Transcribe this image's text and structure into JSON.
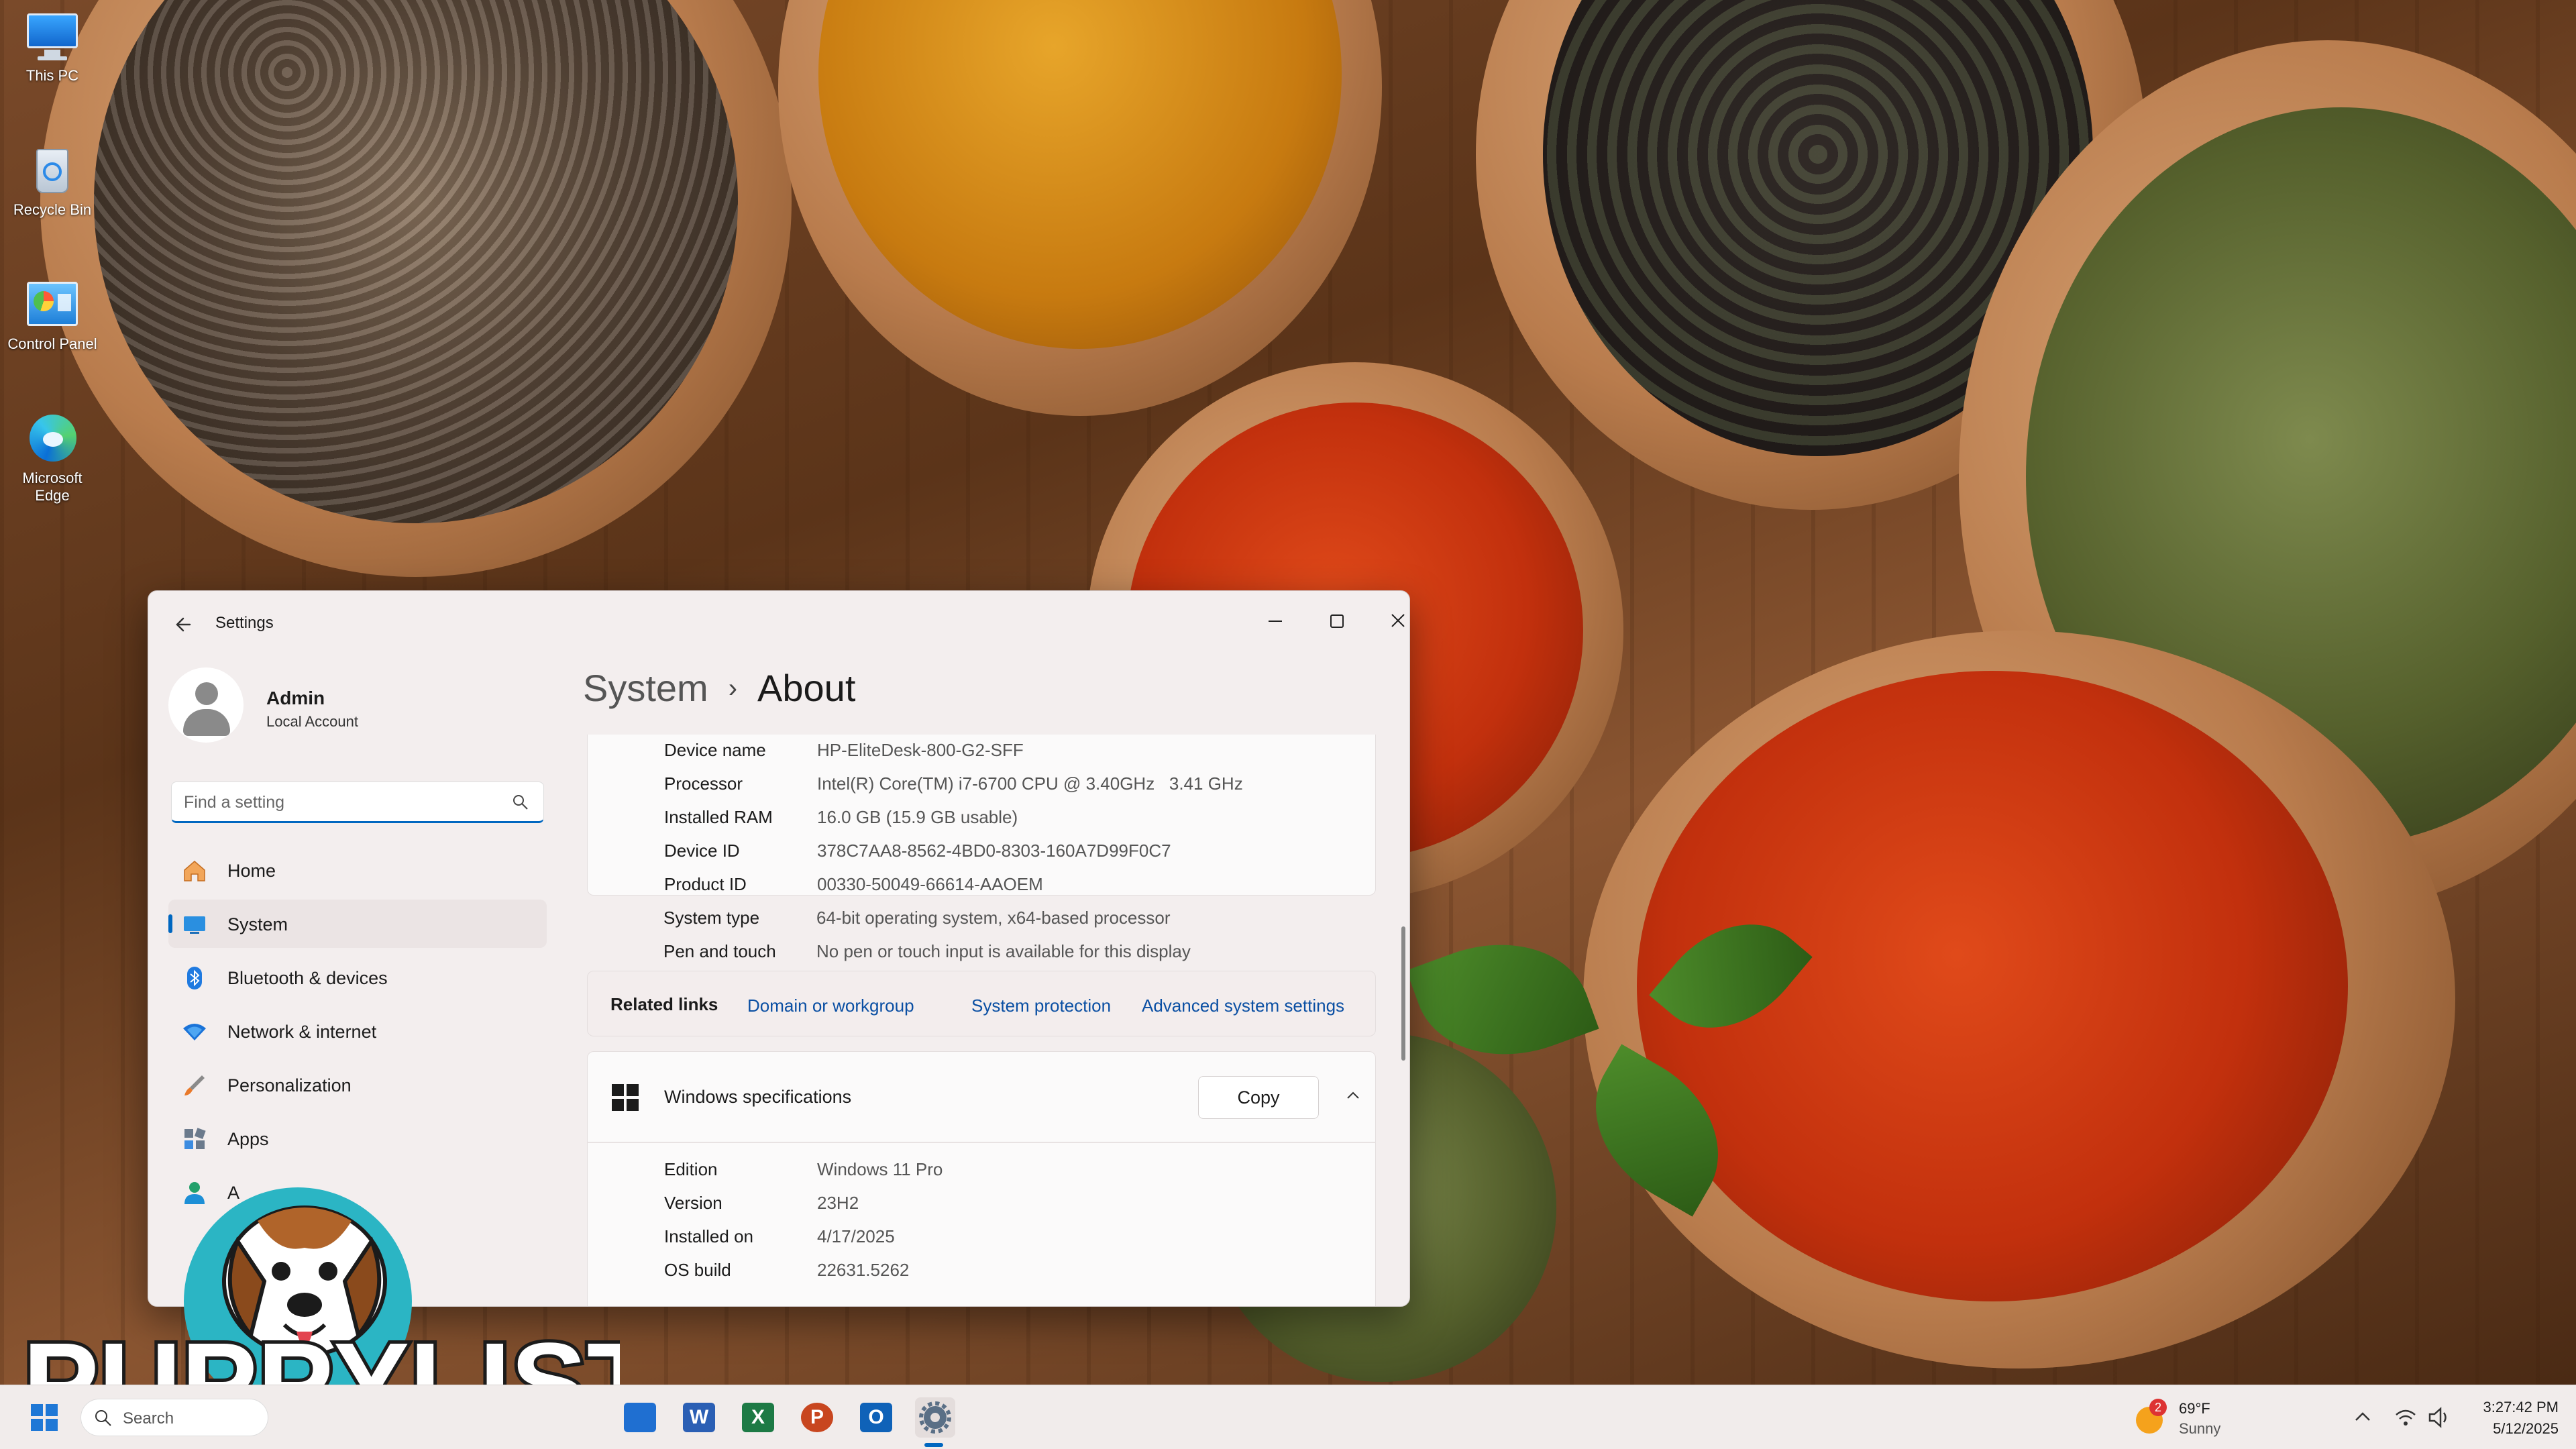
{
  "desktop": {
    "icons": [
      {
        "label": "This PC",
        "icon": "monitor-icon"
      },
      {
        "label": "Recycle Bin",
        "icon": "recycle-bin-icon"
      },
      {
        "label": "Control Panel",
        "icon": "control-panel-icon"
      },
      {
        "label": "Microsoft Edge",
        "icon": "edge-icon"
      }
    ]
  },
  "window": {
    "title": "Settings",
    "accent": "#0067c0"
  },
  "profile": {
    "name": "Admin",
    "account_type": "Local Account"
  },
  "search": {
    "placeholder": "Find a setting"
  },
  "nav": {
    "items": [
      {
        "label": "Home",
        "icon": "home-icon"
      },
      {
        "label": "System",
        "icon": "system-icon",
        "selected": true
      },
      {
        "label": "Bluetooth & devices",
        "icon": "bluetooth-icon"
      },
      {
        "label": "Network & internet",
        "icon": "network-icon"
      },
      {
        "label": "Personalization",
        "icon": "brush-icon"
      },
      {
        "label": "Apps",
        "icon": "apps-icon"
      },
      {
        "label": "A",
        "icon": "accounts-icon"
      }
    ]
  },
  "breadcrumb": {
    "parent": "System",
    "separator": "›",
    "current": "About"
  },
  "device_specs": {
    "rows": [
      {
        "key": "Device name",
        "value": "HP-EliteDesk-800-G2-SFF"
      },
      {
        "key": "Processor",
        "value": "Intel(R) Core(TM) i7-6700 CPU @ 3.40GHz   3.41 GHz"
      },
      {
        "key": "Installed RAM",
        "value": "16.0 GB (15.9 GB usable)"
      },
      {
        "key": "Device ID",
        "value": "378C7AA8-8562-4BD0-8303-160A7D99F0C7"
      },
      {
        "key": "Product ID",
        "value": "00330-50049-66614-AAOEM"
      },
      {
        "key": "System type",
        "value": "64-bit operating system, x64-based processor"
      },
      {
        "key": "Pen and touch",
        "value": "No pen or touch input is available for this display"
      }
    ]
  },
  "related_links": {
    "label": "Related links",
    "links": [
      "Domain or workgroup",
      "System protection",
      "Advanced system settings"
    ]
  },
  "windows_specs": {
    "title": "Windows specifications",
    "copy_label": "Copy",
    "rows": [
      {
        "key": "Edition",
        "value": "Windows 11 Pro"
      },
      {
        "key": "Version",
        "value": "23H2"
      },
      {
        "key": "Installed on",
        "value": "4/17/2025"
      },
      {
        "key": "OS build",
        "value": "22631.5262"
      }
    ]
  },
  "watermark": {
    "text": "PUPPYLIST"
  },
  "taskbar": {
    "search_text": "Search",
    "apps": [
      {
        "name": "store-icon",
        "letter": "",
        "color": "#1f6fd1"
      },
      {
        "name": "word-icon",
        "letter": "W",
        "color": "#2b5fb4"
      },
      {
        "name": "excel-icon",
        "letter": "X",
        "color": "#1d7a45"
      },
      {
        "name": "powerpoint-icon",
        "letter": "P",
        "color": "#c8461f"
      },
      {
        "name": "outlook-icon",
        "letter": "O",
        "color": "#0f62b8"
      },
      {
        "name": "settings-icon",
        "letter": "",
        "color": "#5a6f86"
      }
    ],
    "weather": {
      "badge": "2",
      "temp": "69°F",
      "condition": "Sunny"
    },
    "clock": {
      "time": "3:27:42 PM",
      "date": "5/12/2025"
    }
  }
}
